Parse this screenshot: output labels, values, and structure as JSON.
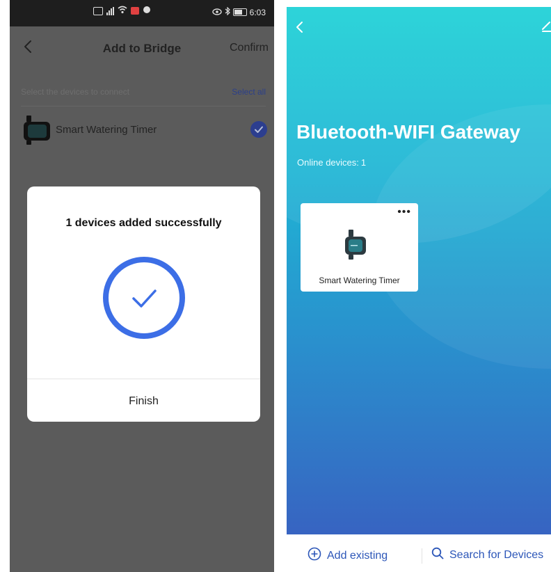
{
  "left_screen": {
    "status_bar": {
      "time": "6:03"
    },
    "header": {
      "title": "Add to Bridge",
      "confirm_label": "Confirm"
    },
    "select_row": {
      "hint": "Select the devices to connect",
      "select_all_label": "Select all"
    },
    "devices": [
      {
        "name": "Smart Watering Timer",
        "selected": true
      }
    ],
    "dialog": {
      "message": "1 devices added successfully",
      "finish_label": "Finish",
      "accent_color": "#3c6ee6"
    }
  },
  "right_screen": {
    "title": "Bluetooth-WIFI Gateway",
    "online_label": "Online devices:",
    "online_count": "1",
    "card": {
      "more_label": "•••",
      "device_name": "Smart Watering Timer"
    },
    "bottom_bar": {
      "add_existing_label": "Add existing",
      "search_label": "Search for Devices",
      "accent_color": "#2c56b8"
    }
  }
}
